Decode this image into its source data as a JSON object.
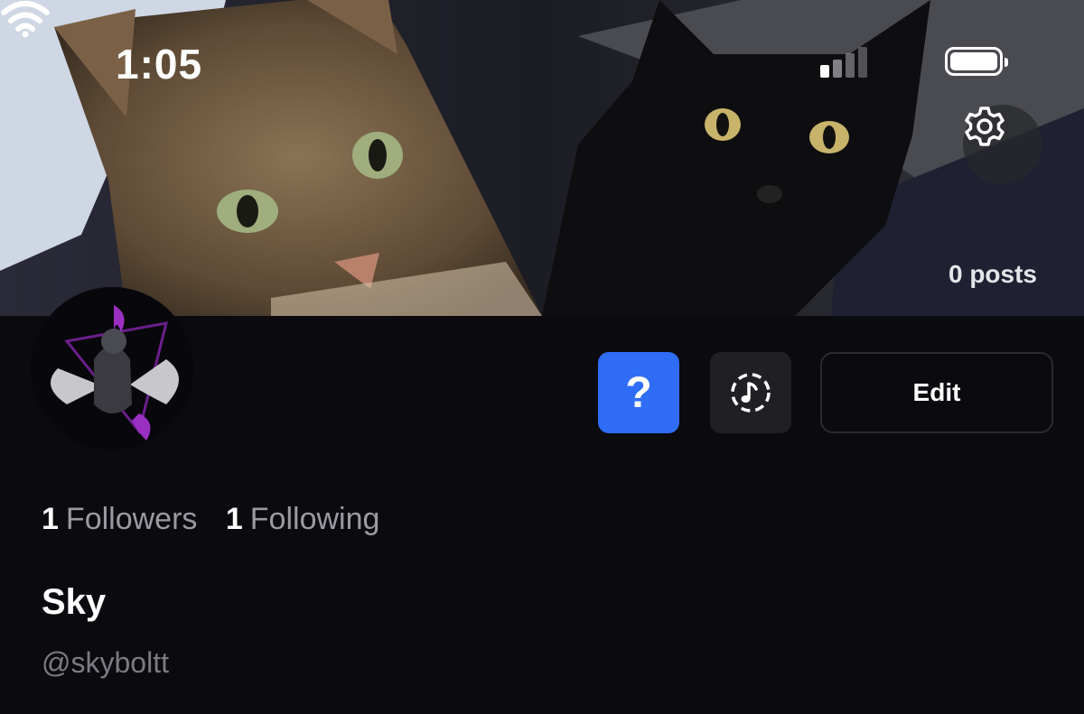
{
  "status_bar": {
    "time": "1:05"
  },
  "banner": {
    "posts_count": "0 posts"
  },
  "actions": {
    "help_label": "?",
    "edit_label": "Edit"
  },
  "stats": {
    "followers_count": "1",
    "followers_label": "Followers",
    "following_count": "1",
    "following_label": "Following"
  },
  "profile": {
    "display_name": "Sky",
    "handle": "@skyboltt"
  },
  "colors": {
    "accent": "#2f6df6",
    "background": "#0b0a0e",
    "muted_text": "#9a9aa2"
  },
  "icons": [
    "settings-gear-icon",
    "music-note-icon",
    "wifi-icon",
    "signal-icon",
    "battery-icon"
  ]
}
